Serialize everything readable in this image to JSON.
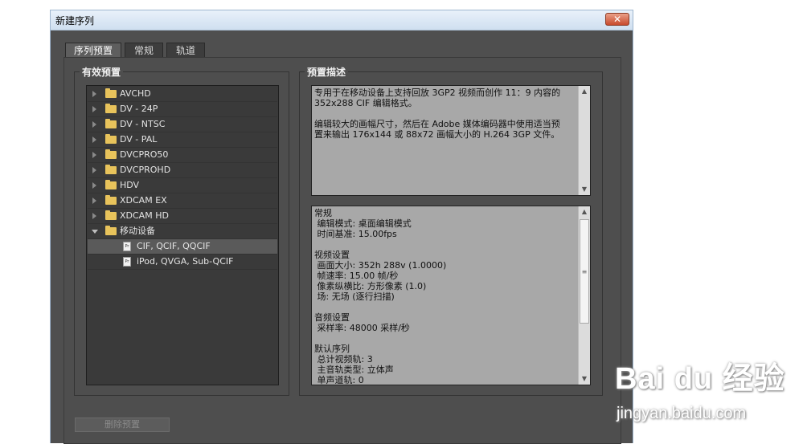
{
  "window": {
    "title": "新建序列",
    "close_symbol": "✕"
  },
  "tabs": [
    {
      "label": "序列预置",
      "active": true
    },
    {
      "label": "常规",
      "active": false
    },
    {
      "label": "轨道",
      "active": false
    }
  ],
  "presets_panel": {
    "label": "有效预置",
    "items": [
      {
        "label": "AVCHD",
        "type": "folder",
        "expanded": false
      },
      {
        "label": "DV - 24P",
        "type": "folder",
        "expanded": false
      },
      {
        "label": "DV - NTSC",
        "type": "folder",
        "expanded": false
      },
      {
        "label": "DV - PAL",
        "type": "folder",
        "expanded": false
      },
      {
        "label": "DVCPRO50",
        "type": "folder",
        "expanded": false
      },
      {
        "label": "DVCPROHD",
        "type": "folder",
        "expanded": false
      },
      {
        "label": "HDV",
        "type": "folder",
        "expanded": false
      },
      {
        "label": "XDCAM EX",
        "type": "folder",
        "expanded": false
      },
      {
        "label": "XDCAM HD",
        "type": "folder",
        "expanded": false
      },
      {
        "label": "移动设备",
        "type": "folder",
        "expanded": true
      },
      {
        "label": "CIF, QCIF, QQCIF",
        "type": "preset",
        "selected": true
      },
      {
        "label": "iPod, QVGA, Sub-QCIF",
        "type": "preset",
        "selected": false
      }
    ],
    "preset_icon_text": "Pr"
  },
  "description_panel": {
    "label": "预置描述",
    "description_lines": [
      "专用于在移动设备上支持回放 3GP2 视频而创作 11：9 内容的",
      "352x288 CIF 编辑格式。",
      "",
      "编辑较大的画幅尺寸，然后在 Adobe 媒体编码器中使用适当预",
      "置来输出 176x144 或 88x72 画幅大小的 H.264 3GP 文件。"
    ],
    "details_lines": [
      "常规",
      " 编辑模式: 桌面编辑模式",
      " 时间基准: 15.00fps",
      "",
      "视频设置",
      " 画面大小: 352h 288v (1.0000)",
      " 帧速率: 15.00 帧/秒",
      " 像素纵横比: 方形像素 (1.0)",
      " 场: 无场 (逐行扫描)",
      "",
      "音频设置",
      " 采样率: 48000 采样/秒",
      "",
      "默认序列",
      " 总计视频轨: 3",
      " 主音轨类型: 立体声",
      " 单声道轨: 0"
    ]
  },
  "buttons": {
    "delete_preset": "删除预置"
  },
  "watermark": {
    "logo": "Bai du 经验",
    "url": "jingyan.baidu.com"
  }
}
